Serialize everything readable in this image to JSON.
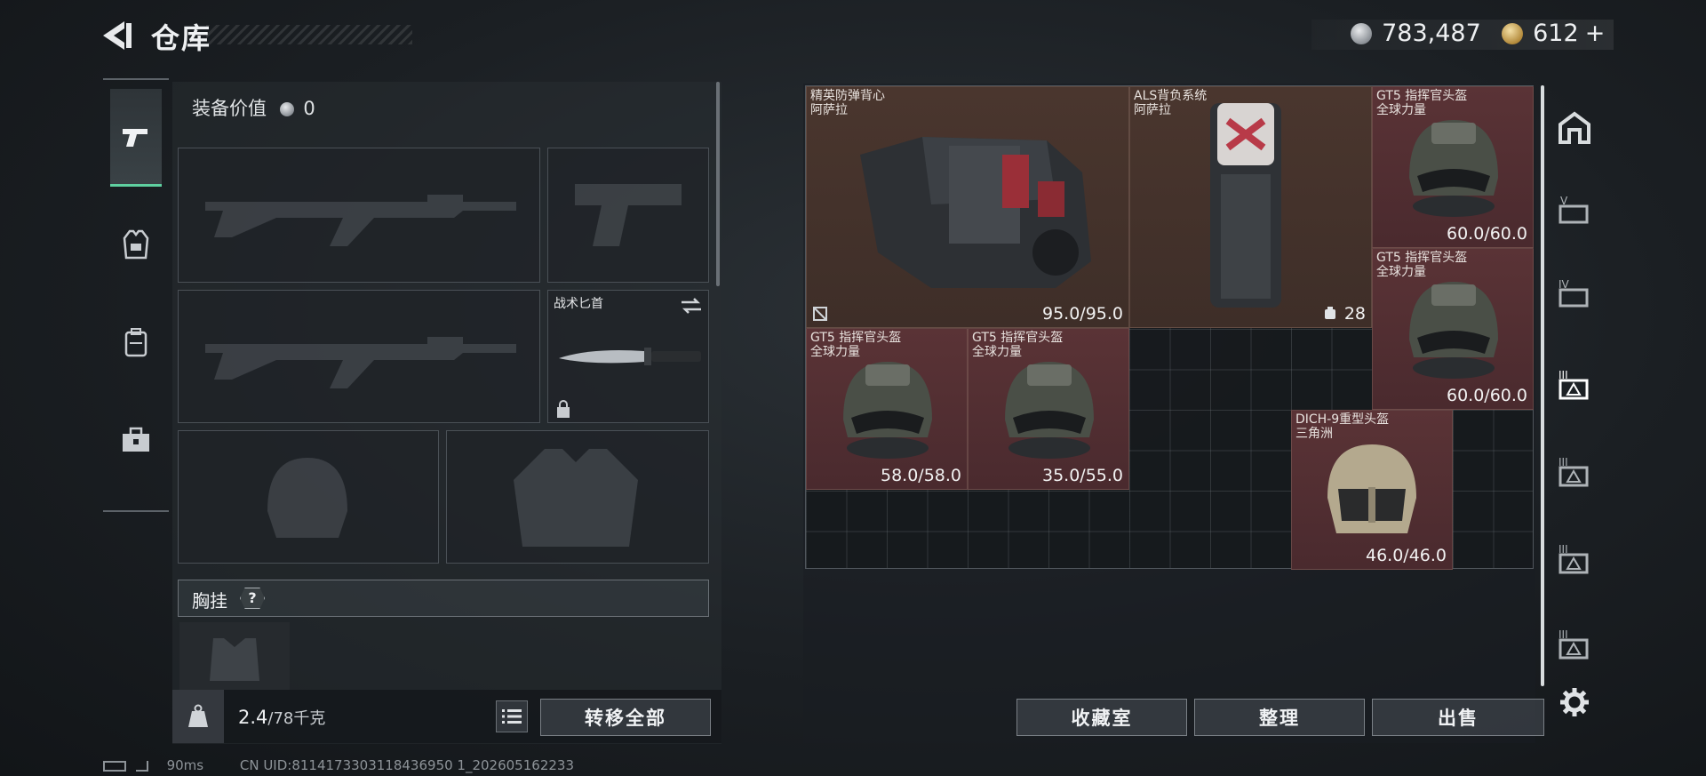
{
  "header": {
    "title": "仓库",
    "currency_silver": "783,487",
    "currency_gold": "612",
    "gold_plus": "+"
  },
  "left_tabs": [
    {
      "icon": "pistol-icon",
      "active": true
    },
    {
      "icon": "armor-vest-icon",
      "active": false
    },
    {
      "icon": "backpack-icon",
      "active": false
    },
    {
      "icon": "toolbox-icon",
      "active": false
    }
  ],
  "equipment": {
    "value_label": "装备价值",
    "value": "0",
    "knife_label": "战术匕首",
    "chest_rig_label": "胸挂",
    "help": "?",
    "weight_value": "2.4",
    "weight_max": "/78千克",
    "transfer_all": "转移全部"
  },
  "stash": {
    "items": [
      {
        "name": "精英防弹背心",
        "sub": "阿萨拉",
        "durability": "95.0/95.0",
        "color": "brown"
      },
      {
        "name": "ALS背负系统",
        "sub": "阿萨拉",
        "durability": "28",
        "color": "brown"
      },
      {
        "name": "GT5 指挥官头盔",
        "sub": "全球力量",
        "durability": "60.0/60.0",
        "color": "red"
      },
      {
        "name": "GT5 指挥官头盔",
        "sub": "全球力量",
        "durability": "60.0/60.0",
        "color": "red"
      },
      {
        "name": "GT5 指挥官头盔",
        "sub": "全球力量",
        "durability": "58.0/58.0",
        "color": "red"
      },
      {
        "name": "GT5 指挥官头盔",
        "sub": "全球力量",
        "durability": "35.0/55.0",
        "color": "red"
      },
      {
        "name": "DICH-9重型头盔",
        "sub": "三角洲",
        "durability": "46.0/46.0",
        "color": "red"
      }
    ],
    "buttons": {
      "collection": "收藏室",
      "organize": "整理",
      "sell": "出售"
    }
  },
  "container_tabs": [
    "home-icon",
    "container-v-icon",
    "container-iv-icon",
    "container-iii-icon",
    "container-iii-icon",
    "container-iii-icon",
    "container-iii-icon",
    "gear-icon"
  ],
  "status": {
    "ping": "90ms",
    "uid": "CN UID:8114173303118436950 1_202605162233"
  },
  "colors": {
    "accent": "#5fd0a0",
    "item_brown": "#4a362e",
    "item_red": "#5a3336"
  }
}
